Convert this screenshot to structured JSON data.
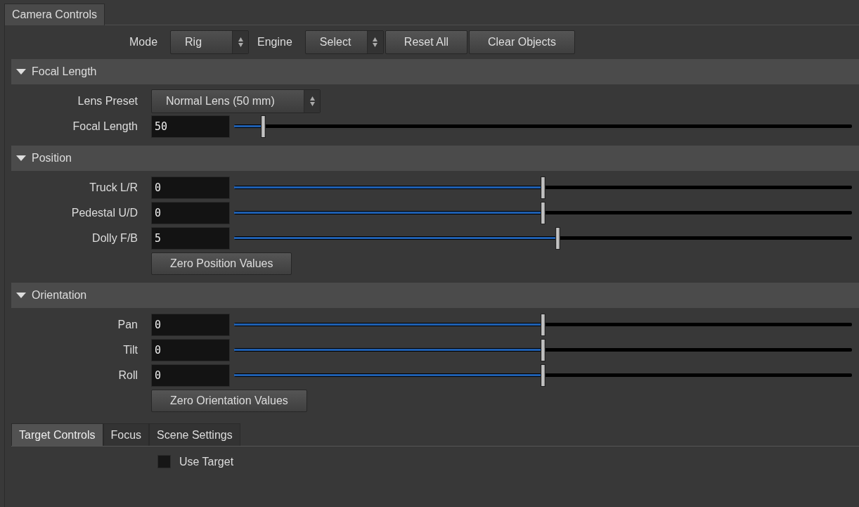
{
  "tabs": [
    {
      "label": "Camera Controls",
      "selected": true
    }
  ],
  "toolbar": [
    {
      "kind": "label",
      "text": "Mode"
    },
    {
      "kind": "select",
      "value": "Rig"
    },
    {
      "kind": "label",
      "text": "Engine"
    },
    {
      "kind": "select",
      "value": "Select"
    },
    {
      "kind": "button",
      "text": "Reset All"
    },
    {
      "kind": "button",
      "text": "Clear Objects"
    }
  ],
  "sections": [
    {
      "title": "Focal Length",
      "expanded": true,
      "rows": [
        {
          "kind": "select",
          "label": "Lens Preset",
          "value": "Normal Lens (50 mm)"
        },
        {
          "kind": "slider",
          "label": "Focal Length",
          "value": "50",
          "level": 0.048
        }
      ]
    },
    {
      "title": "Position",
      "expanded": true,
      "rows": [
        {
          "kind": "slider",
          "label": "Truck L/R",
          "value": "0",
          "level": 0.5
        },
        {
          "kind": "slider",
          "label": "Pedestal U/D",
          "value": "0",
          "level": 0.5
        },
        {
          "kind": "slider",
          "label": "Dolly F/B",
          "value": "5",
          "level": 0.525
        },
        {
          "kind": "button",
          "text": "Zero Position Values"
        }
      ]
    },
    {
      "title": "Orientation",
      "expanded": true,
      "rows": [
        {
          "kind": "slider",
          "label": "Pan",
          "value": "0",
          "level": 0.5
        },
        {
          "kind": "slider",
          "label": "Tilt",
          "value": "0",
          "level": 0.5
        },
        {
          "kind": "slider",
          "label": "Roll",
          "value": "0",
          "level": 0.5
        },
        {
          "kind": "button",
          "text": "Zero Orientation Values"
        }
      ]
    }
  ],
  "bottom_tabs": [
    {
      "label": "Target Controls",
      "selected": true
    },
    {
      "label": "Focus",
      "selected": false
    },
    {
      "label": "Scene Settings",
      "selected": false
    }
  ],
  "use_target": {
    "label": "Use Target",
    "checked": false
  }
}
